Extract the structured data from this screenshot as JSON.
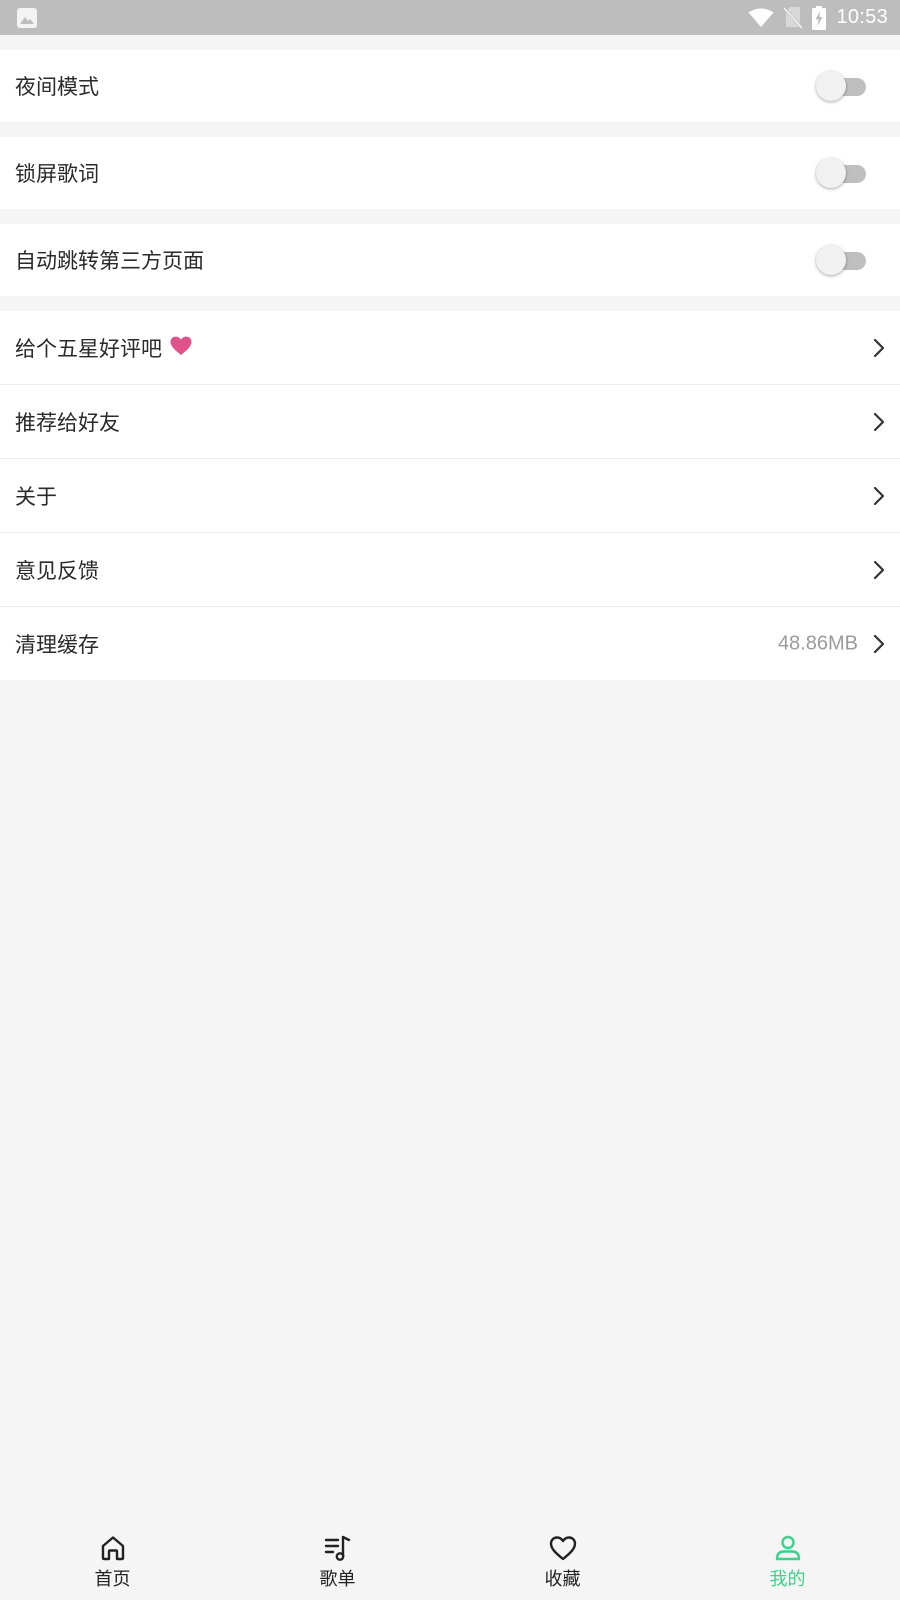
{
  "status_bar": {
    "time": "10:53",
    "icons": [
      "gallery-notification-icon",
      "wifi-icon",
      "no-sim-icon",
      "battery-charging-icon"
    ]
  },
  "settings": {
    "toggles": [
      {
        "label": "夜间模式",
        "on": false
      },
      {
        "label": "锁屏歌词",
        "on": false
      },
      {
        "label": "自动跳转第三方页面",
        "on": false
      }
    ],
    "items": [
      {
        "label": "给个五星好评吧",
        "icon": "heart-icon"
      },
      {
        "label": "推荐给好友"
      },
      {
        "label": "关于"
      },
      {
        "label": "意见反馈"
      },
      {
        "label": "清理缓存",
        "value": "48.86MB"
      }
    ]
  },
  "tabbar": {
    "tabs": [
      {
        "label": "首页",
        "icon": "home-icon",
        "active": false
      },
      {
        "label": "歌单",
        "icon": "playlist-icon",
        "active": false
      },
      {
        "label": "收藏",
        "icon": "heart-outline-icon",
        "active": false
      },
      {
        "label": "我的",
        "icon": "user-icon",
        "active": true
      }
    ]
  },
  "colors": {
    "accent": "#3fd18c",
    "heart": "#e0528a",
    "status_bar": "#bdbdbd",
    "background": "#f5f5f5"
  }
}
